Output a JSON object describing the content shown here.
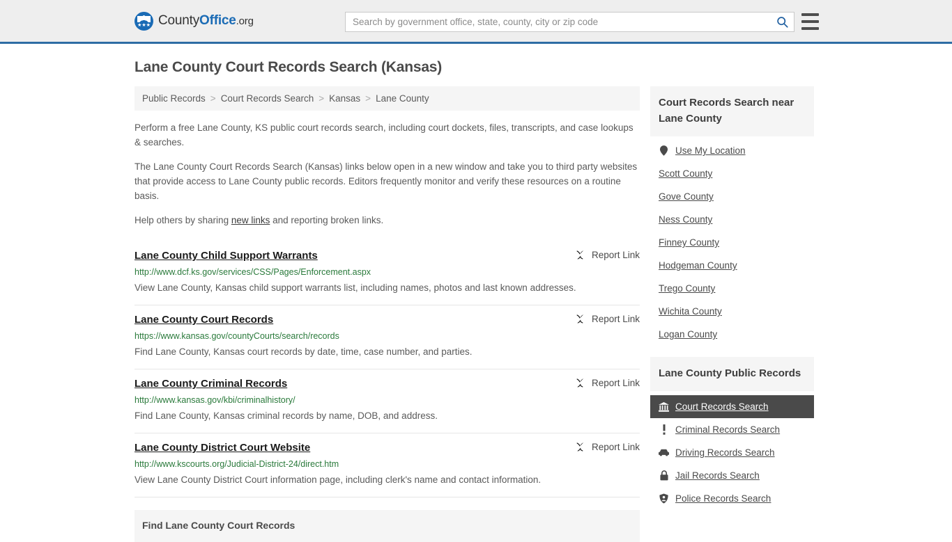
{
  "header": {
    "brand": {
      "part1": "County",
      "part2": "Office",
      "part3": ".org",
      "stars": "★★★"
    },
    "search": {
      "placeholder": "Search by government office, state, county, city or zip code",
      "value": "",
      "search_icon": "search-icon"
    },
    "menu_icon": "hamburger-menu-icon",
    "accent_color": "#2e6da4"
  },
  "page": {
    "title": "Lane County Court Records Search (Kansas)"
  },
  "breadcrumb": {
    "separator": ">",
    "items": [
      {
        "label": "Public Records"
      },
      {
        "label": "Court Records Search"
      },
      {
        "label": "Kansas"
      },
      {
        "label": "Lane County"
      }
    ]
  },
  "intro": {
    "p1": "Perform a free Lane County, KS public court records search, including court dockets, files, transcripts, and case lookups & searches.",
    "p2": "The Lane County Court Records Search (Kansas) links below open in a new window and take you to third party websites that provide access to Lane County public records. Editors frequently monitor and verify these resources on a routine basis.",
    "p3_before": "Help others by sharing ",
    "p3_link": "new links",
    "p3_after": " and reporting broken links."
  },
  "results": {
    "report_label": "Report Link",
    "report_icon": "broken-link-icon",
    "items": [
      {
        "title": "Lane County Child Support Warrants",
        "url": "http://www.dcf.ks.gov/services/CSS/Pages/Enforcement.aspx",
        "description": "View Lane County, Kansas child support warrants list, including names, photos and last known addresses."
      },
      {
        "title": "Lane County Court Records",
        "url": "https://www.kansas.gov/countyCourts/search/records",
        "description": "Find Lane County, Kansas court records by date, time, case number, and parties."
      },
      {
        "title": "Lane County Criminal Records",
        "url": "http://www.kansas.gov/kbi/criminalhistory/",
        "description": "Find Lane County, Kansas criminal records by name, DOB, and address."
      },
      {
        "title": "Lane County District Court Website",
        "url": "http://www.kscourts.org/Judicial-District-24/direct.htm",
        "description": "View Lane County District Court information page, including clerk's name and contact information."
      }
    ]
  },
  "find_section": {
    "title": "Find Lane County Court Records"
  },
  "sidebar": {
    "nearby": {
      "heading": "Court Records Search near Lane County",
      "use_my_location": {
        "label": "Use My Location",
        "icon": "map-pin-icon"
      },
      "counties": [
        {
          "label": "Scott County"
        },
        {
          "label": "Gove County"
        },
        {
          "label": "Ness County"
        },
        {
          "label": "Finney County"
        },
        {
          "label": "Hodgeman County"
        },
        {
          "label": "Trego County"
        },
        {
          "label": "Wichita County"
        },
        {
          "label": "Logan County"
        }
      ]
    },
    "public_records": {
      "heading": "Lane County Public Records",
      "items": [
        {
          "label": "Court Records Search",
          "icon": "courthouse-icon",
          "active": true
        },
        {
          "label": "Criminal Records Search",
          "icon": "exclamation-icon",
          "active": false
        },
        {
          "label": "Driving Records Search",
          "icon": "car-icon",
          "active": false
        },
        {
          "label": "Jail Records Search",
          "icon": "lock-icon",
          "active": false
        },
        {
          "label": "Police Records Search",
          "icon": "shield-icon",
          "active": false
        }
      ],
      "active_bg": "#4a4a4a"
    }
  }
}
